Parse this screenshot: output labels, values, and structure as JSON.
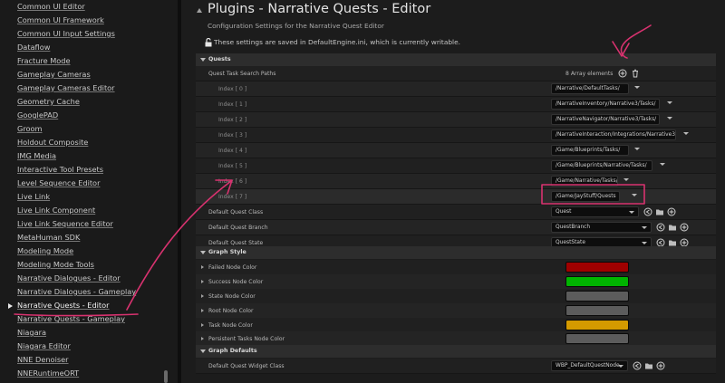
{
  "sidebar": {
    "items": [
      {
        "label": "Common UI Editor"
      },
      {
        "label": "Common UI Framework"
      },
      {
        "label": "Common UI Input Settings"
      },
      {
        "label": "Dataflow"
      },
      {
        "label": "Fracture Mode"
      },
      {
        "label": "Gameplay Cameras"
      },
      {
        "label": "Gameplay Cameras Editor"
      },
      {
        "label": "Geometry Cache"
      },
      {
        "label": "GooglePAD"
      },
      {
        "label": "Groom"
      },
      {
        "label": "Holdout Composite"
      },
      {
        "label": "IMG Media"
      },
      {
        "label": "Interactive Tool Presets"
      },
      {
        "label": "Level Sequence Editor"
      },
      {
        "label": "Live Link"
      },
      {
        "label": "Live Link Component"
      },
      {
        "label": "Live Link Sequence Editor"
      },
      {
        "label": "MetaHuman SDK"
      },
      {
        "label": "Modeling Mode"
      },
      {
        "label": "Modeling Mode Tools"
      },
      {
        "label": "Narrative Dialogues - Editor"
      },
      {
        "label": "Narrative Dialogues - Gameplay"
      },
      {
        "label": "Narrative Quests - Editor"
      },
      {
        "label": "Narrative Quests - Gameplay"
      },
      {
        "label": "Niagara"
      },
      {
        "label": "Niagara Editor"
      },
      {
        "label": "NNE Denoiser"
      },
      {
        "label": "NNERuntimeORT"
      }
    ]
  },
  "header": {
    "title": "Plugins - Narrative Quests - Editor",
    "subtitle": "Configuration Settings for the Narrative Quest Editor",
    "note": "These settings are saved in DefaultEngine.ini, which is currently writable."
  },
  "sections": {
    "quests": "Quests",
    "graph_style": "Graph Style",
    "graph_defaults": "Graph Defaults"
  },
  "quests": {
    "search_paths_label": "Quest Task Search Paths",
    "array_count": "8 Array elements",
    "paths": [
      {
        "index": "Index [ 0 ]",
        "value": "/Narrative/DefaultTasks/"
      },
      {
        "index": "Index [ 1 ]",
        "value": "/NarrativeInventory/Narrative3/Tasks/"
      },
      {
        "index": "Index [ 2 ]",
        "value": "/NarrativeNavigator/Narrative3/Tasks/"
      },
      {
        "index": "Index [ 3 ]",
        "value": "/NarrativeInteraction/Integrations/Narrative3/"
      },
      {
        "index": "Index [ 4 ]",
        "value": "/Game/Blueprints/Tasks/"
      },
      {
        "index": "Index [ 5 ]",
        "value": "/Game/Blueprints/Narrative/Tasks/"
      },
      {
        "index": "Index [ 6 ]",
        "value": "/Game/Narrative/Tasks/"
      },
      {
        "index": "Index [ 7 ]",
        "value": "/Game/JayStuff/Quests"
      }
    ],
    "default_class_label": "Default Quest Class",
    "default_class_value": "Quest",
    "default_branch_label": "Default Quest Branch",
    "default_branch_value": "QuestBranch",
    "default_state_label": "Default Quest State",
    "default_state_value": "QuestState"
  },
  "graph_style": {
    "items": [
      {
        "label": "Failed Node Color",
        "color": "#a00000"
      },
      {
        "label": "Success Node Color",
        "color": "#00b400"
      },
      {
        "label": "State Node Color",
        "color": "#5c5c5c"
      },
      {
        "label": "Root Node Color",
        "color": "#5c5c5c"
      },
      {
        "label": "Task Node Color",
        "color": "#d49a00"
      },
      {
        "label": "Persistent Tasks Node Color",
        "color": "#5c5c5c"
      }
    ]
  },
  "graph_defaults": {
    "widget_label": "Default Quest Widget Class",
    "widget_value": "WBP_DefaultQuestNode"
  },
  "icons": {
    "lock": "lock-open-icon",
    "add": "add-element-icon",
    "delete": "trash-icon",
    "reset": "reset-arrow-icon",
    "browse": "browse-folder-icon",
    "use": "use-selected-icon"
  },
  "colors": {
    "annotation": "#d8326f"
  }
}
